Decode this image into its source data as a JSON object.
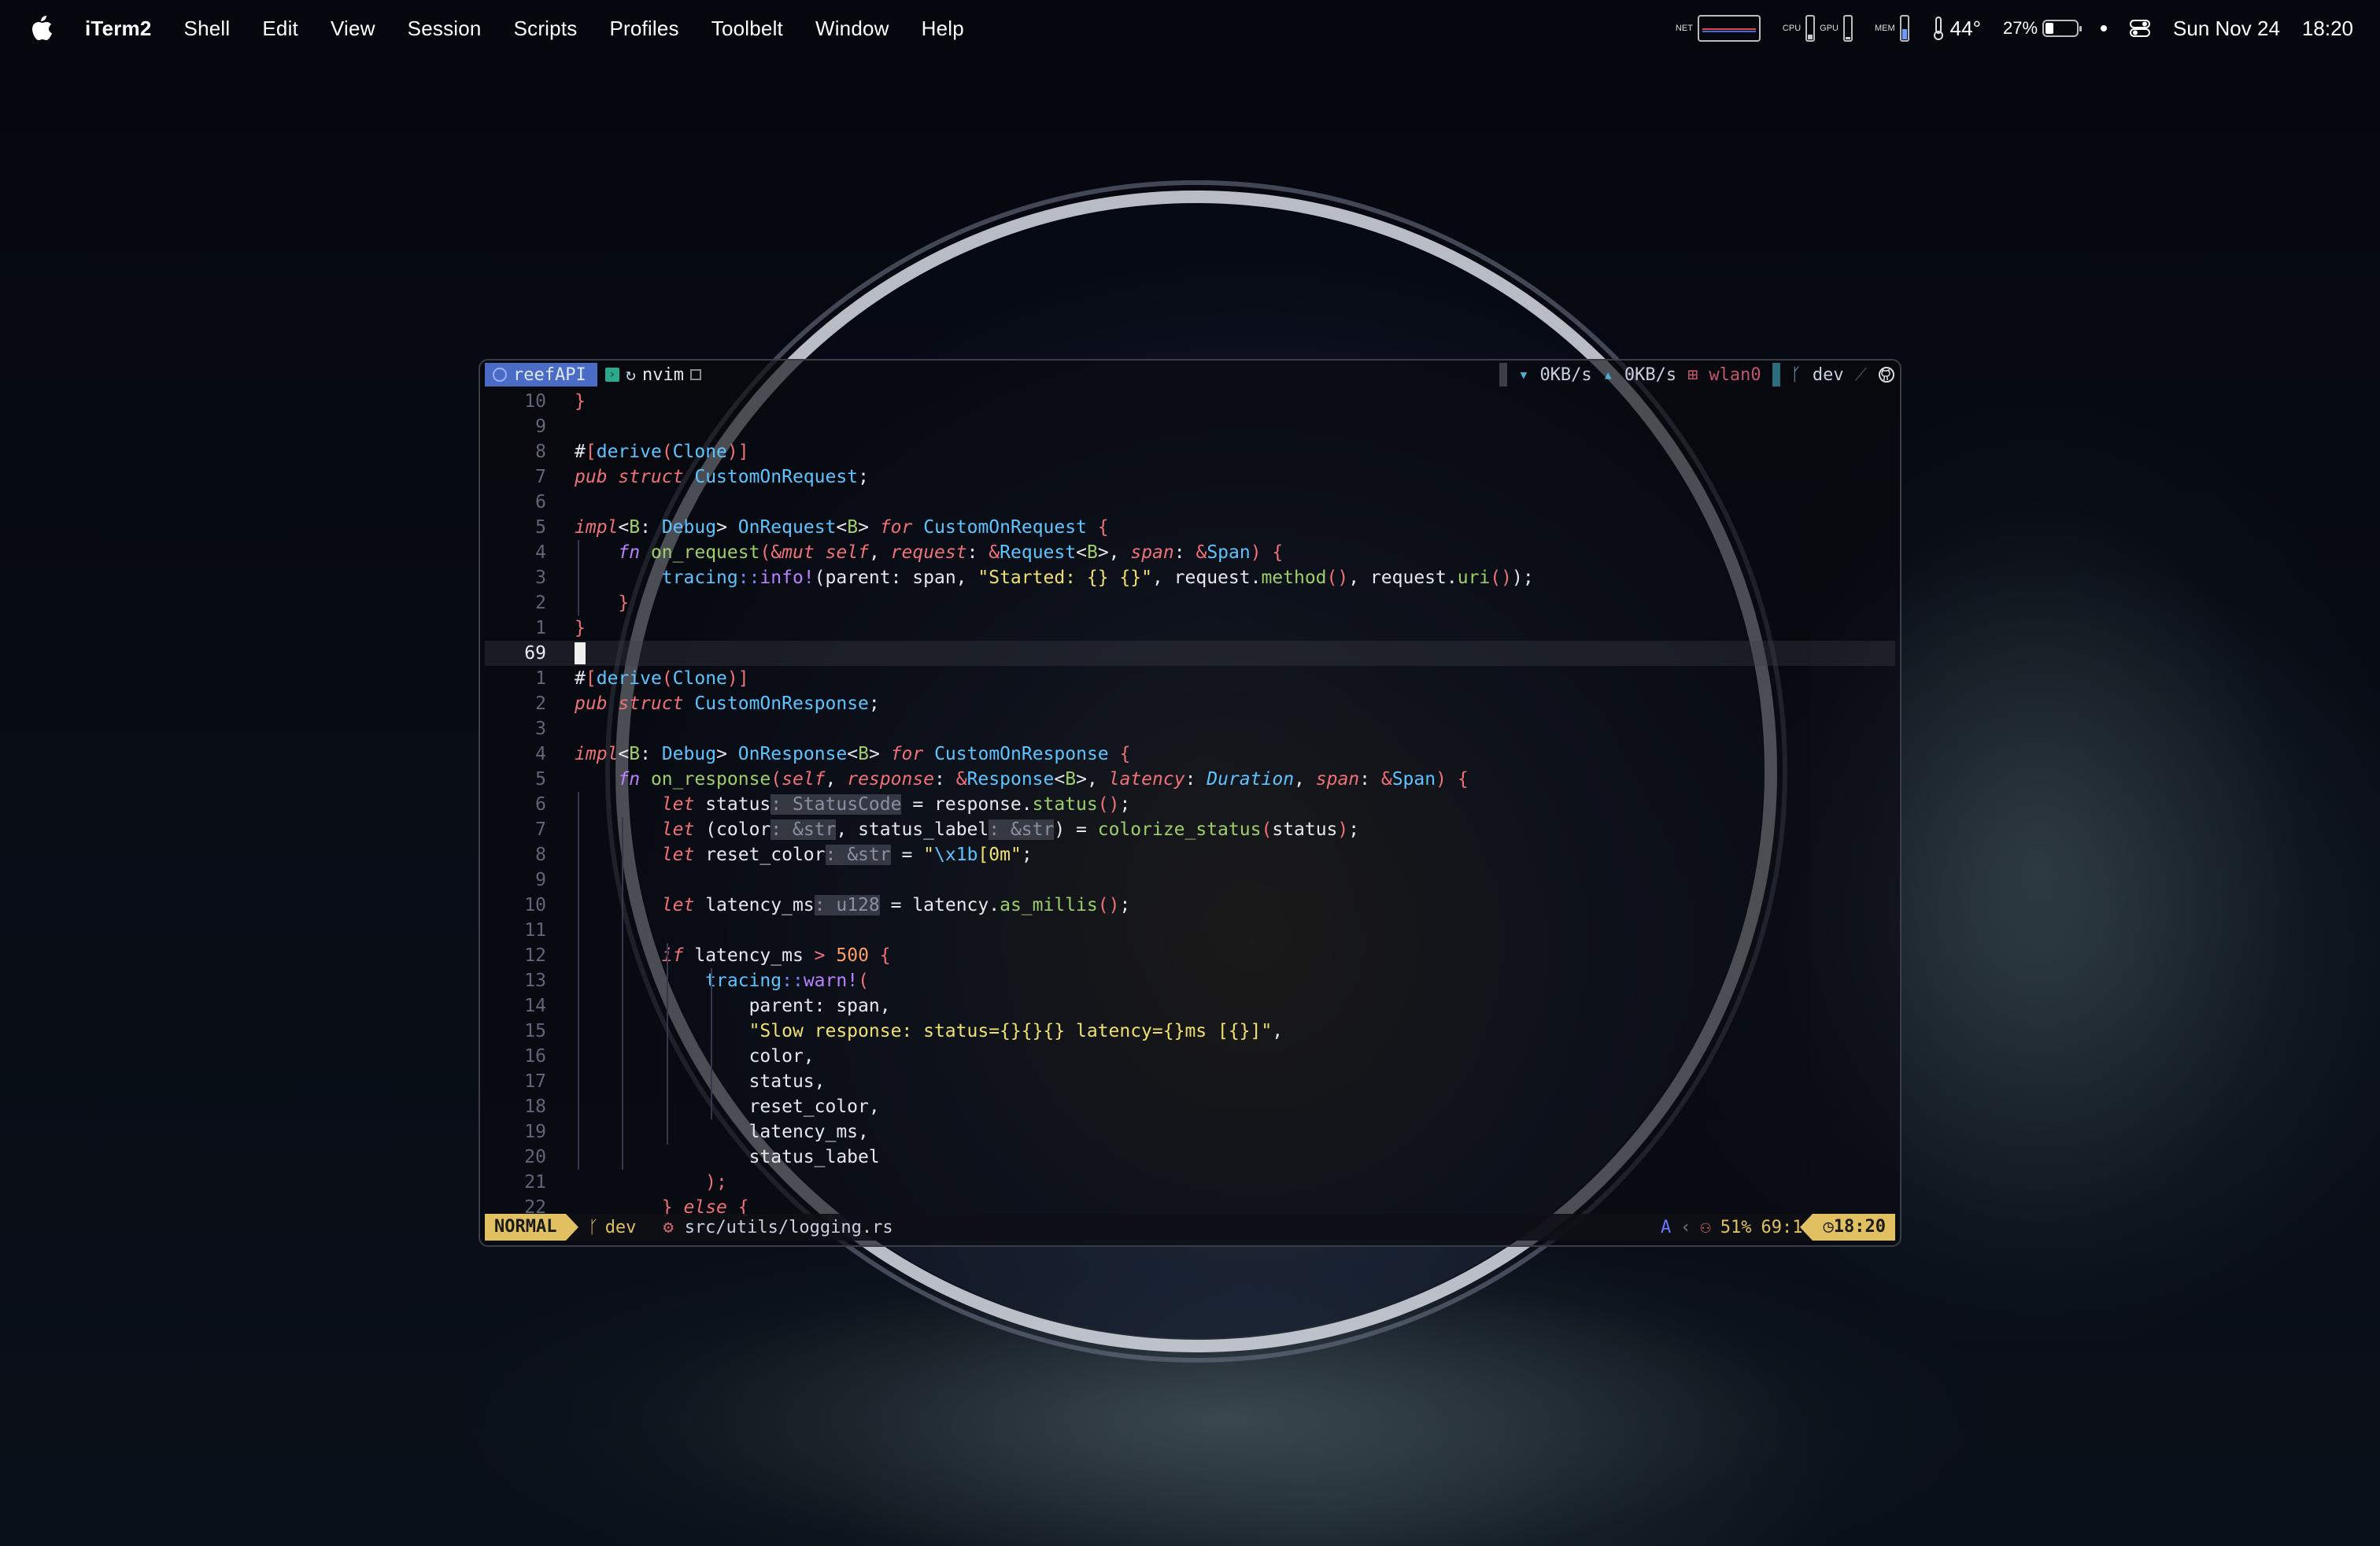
{
  "menubar": {
    "app_name": "iTerm2",
    "menus": [
      "Shell",
      "Edit",
      "View",
      "Session",
      "Scripts",
      "Profiles",
      "Toolbelt",
      "Window",
      "Help"
    ],
    "status": {
      "net_label": "NET",
      "cpu_label": "CPU",
      "gpu_label": "GPU",
      "mem_label": "MEM",
      "temperature": "44°",
      "battery_percent": "27%",
      "battery_level": 0.27,
      "date": "Sun Nov 24",
      "time": "18:20"
    }
  },
  "tmux": {
    "session_name": "reefAPI",
    "window_name": "nvim",
    "net_down": "0KB/s",
    "net_up": "0KB/s",
    "interface": "wlan0",
    "branch": "dev"
  },
  "editor": {
    "lines": [
      {
        "n": "10",
        "html": "<span class='pun'>}</span>"
      },
      {
        "n": "9",
        "html": ""
      },
      {
        "n": "8",
        "html": "<span class='plain'>#</span><span class='pun'>[</span><span class='attr'>derive</span><span class='pun'>(</span><span class='ty'>Clone</span><span class='pun'>)]</span>"
      },
      {
        "n": "7",
        "html": "<span class='kw'>pub struct</span> <span class='ty'>CustomOnRequest</span><span class='plain'>;</span>"
      },
      {
        "n": "6",
        "html": ""
      },
      {
        "n": "5",
        "html": "<span class='kw'>impl</span><span class='plain'>&lt;</span><span class='tyg'>B</span><span class='plain'>: </span><span class='ty'>Debug</span><span class='plain'>&gt; </span><span class='ty'>OnRequest</span><span class='plain'>&lt;</span><span class='tyg'>B</span><span class='plain'>&gt; </span><span class='kw'>for</span> <span class='ty'>CustomOnRequest</span> <span class='pun'>{</span>"
      },
      {
        "n": "4",
        "html": "    <span class='kw2'>fn</span> <span class='fn'>on_request</span><span class='pun'>(</span><span class='pun'>&amp;</span><span class='kw'>mut</span> <span class='par'>self</span><span class='plain'>, </span><span class='par'>request</span><span class='plain'>: </span><span class='pun'>&amp;</span><span class='ty'>Request</span><span class='plain'>&lt;</span><span class='tyg'>B</span><span class='plain'>&gt;, </span><span class='par'>span</span><span class='plain'>: </span><span class='pun'>&amp;</span><span class='ty'>Span</span><span class='pun'>)</span> <span class='pun'>{</span>"
      },
      {
        "n": "3",
        "html": "        <span class='ty'>tracing</span><span class='ns'>::</span><span class='mac'>info!</span><span class='plain'>(parent: span, </span><span class='str'>\"Started: {} {}\"</span><span class='plain'>, request.</span><span class='fn'>method</span><span class='pun'>()</span><span class='plain'>, request.</span><span class='fn'>uri</span><span class='pun'>()</span><span class='plain'>);</span>"
      },
      {
        "n": "2",
        "html": "    <span class='pun'>}</span>"
      },
      {
        "n": "1",
        "html": "<span class='pun'>}</span>"
      },
      {
        "n": "69",
        "html": "",
        "current": true
      },
      {
        "n": "1",
        "html": "<span class='plain'>#</span><span class='pun'>[</span><span class='attr'>derive</span><span class='pun'>(</span><span class='ty'>Clone</span><span class='pun'>)]</span>"
      },
      {
        "n": "2",
        "html": "<span class='kw'>pub struct</span> <span class='ty'>CustomOnResponse</span><span class='plain'>;</span>"
      },
      {
        "n": "3",
        "html": ""
      },
      {
        "n": "4",
        "html": "<span class='kw'>impl</span><span class='plain'>&lt;</span><span class='tyg'>B</span><span class='plain'>: </span><span class='ty'>Debug</span><span class='plain'>&gt; </span><span class='ty'>OnResponse</span><span class='plain'>&lt;</span><span class='tyg'>B</span><span class='plain'>&gt; </span><span class='kw'>for</span> <span class='ty'>CustomOnResponse</span> <span class='pun'>{</span>"
      },
      {
        "n": "5",
        "html": "    <span class='kw2'>fn</span> <span class='fn'>on_response</span><span class='pun'>(</span><span class='par'>self</span><span class='plain'>, </span><span class='par'>response</span><span class='plain'>: </span><span class='pun'>&amp;</span><span class='ty'>Response</span><span class='plain'>&lt;</span><span class='tyg'>B</span><span class='plain'>&gt;, </span><span class='par'>latency</span><span class='plain'>: </span><span class='ty' style='font-style:italic'>Duration</span><span class='plain'>, </span><span class='par'>span</span><span class='plain'>: </span><span class='pun'>&amp;</span><span class='ty'>Span</span><span class='pun'>)</span> <span class='pun'>{</span>"
      },
      {
        "n": "6",
        "html": "        <span class='kw'>let</span> <span class='plain'>status</span><span class='hint'>: StatusCode</span> <span class='plain'>= response.</span><span class='fn'>status</span><span class='pun'>()</span><span class='plain'>;</span>"
      },
      {
        "n": "7",
        "html": "        <span class='kw'>let</span> <span class='plain'>(color</span><span class='hint'>: &amp;str</span><span class='plain'>, status_label</span><span class='hint'>: &amp;str</span><span class='plain'>) = </span><span class='fn'>colorize_status</span><span class='pun'>(</span><span class='plain'>status</span><span class='pun'>)</span><span class='plain'>;</span>"
      },
      {
        "n": "8",
        "html": "        <span class='kw'>let</span> <span class='plain'>reset_color</span><span class='hint'>: &amp;str</span> <span class='plain'>= </span><span class='str'>\"</span><span class='ty'>\\x1b</span><span class='str'>[0m\"</span><span class='plain'>;</span>"
      },
      {
        "n": "9",
        "html": ""
      },
      {
        "n": "10",
        "html": "        <span class='kw'>let</span> <span class='plain'>latency_ms</span><span class='hint'>: u128</span> <span class='plain'>= latency.</span><span class='fn'>as_millis</span><span class='pun'>()</span><span class='plain'>;</span>"
      },
      {
        "n": "11",
        "html": ""
      },
      {
        "n": "12",
        "html": "        <span class='kw'>if</span> <span class='plain'>latency_ms </span><span class='pun'>&gt;</span> <span class='num'>500</span> <span class='pun'>{</span>"
      },
      {
        "n": "13",
        "html": "            <span class='ty'>tracing</span><span class='ns'>::</span><span class='mac'>warn!</span><span class='pun'>(</span>"
      },
      {
        "n": "14",
        "html": "                <span class='plain'>parent: span,</span>"
      },
      {
        "n": "15",
        "html": "                <span class='str'>\"Slow response: status={}{}{} latency={}ms [{}]\"</span><span class='plain'>,</span>"
      },
      {
        "n": "16",
        "html": "                <span class='plain'>color,</span>"
      },
      {
        "n": "17",
        "html": "                <span class='plain'>status,</span>"
      },
      {
        "n": "18",
        "html": "                <span class='plain'>reset_color,</span>"
      },
      {
        "n": "19",
        "html": "                <span class='plain'>latency_ms,</span>"
      },
      {
        "n": "20",
        "html": "                <span class='plain'>status_label</span>"
      },
      {
        "n": "21",
        "html": "            <span class='pun'>);</span>"
      },
      {
        "n": "22",
        "html": "        <span class='pun'>}</span> <span class='kw'>else</span> <span class='pun'>{</span>"
      }
    ]
  },
  "statusline": {
    "mode": "NORMAL",
    "branch": "dev",
    "filepath": "src/utils/logging.rs",
    "encoding_indicator": "A",
    "progress": "51%",
    "position": "69:1",
    "clock": "18:20"
  }
}
